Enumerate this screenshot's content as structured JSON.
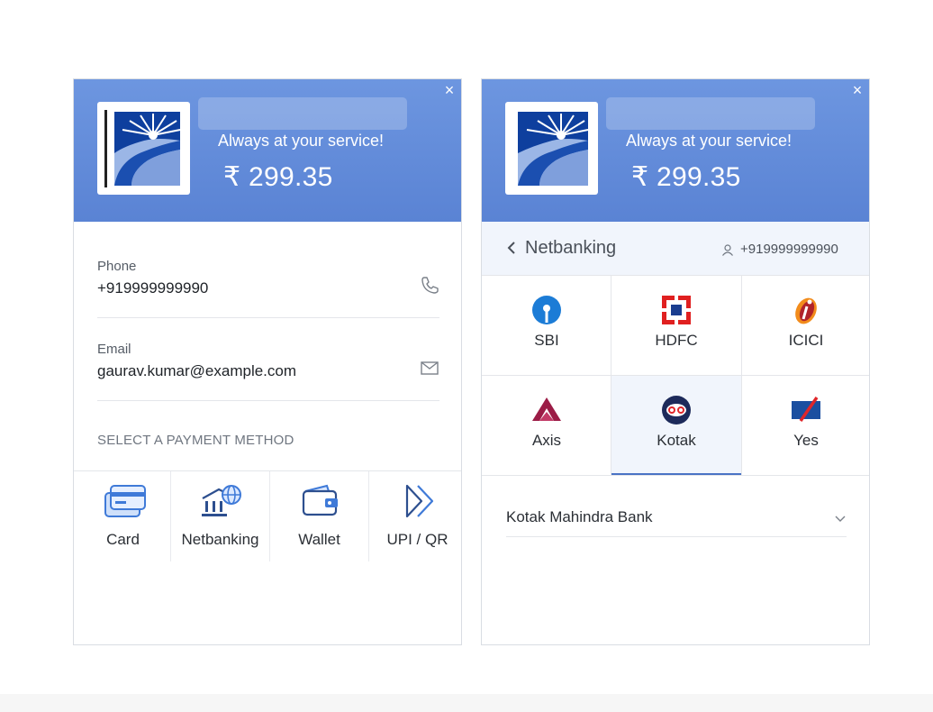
{
  "left_panel": {
    "close_icon": "×",
    "tagline": "Always at your service!",
    "amount": "₹ 299.35",
    "phone": {
      "label": "Phone",
      "value": "+919999999990",
      "icon": "phone-icon"
    },
    "email": {
      "label": "Email",
      "value": "gaurav.kumar@example.com",
      "icon": "envelope-icon"
    },
    "section_label": "SELECT A PAYMENT METHOD",
    "methods": [
      {
        "label": "Card",
        "icon": "card-icon"
      },
      {
        "label": "Netbanking",
        "icon": "bank-globe-icon"
      },
      {
        "label": "Wallet",
        "icon": "wallet-icon"
      },
      {
        "label": "UPI / QR",
        "icon": "upi-icon"
      }
    ]
  },
  "right_panel": {
    "close_icon": "×",
    "tagline": "Always at your service!",
    "amount": "₹ 299.35",
    "nav": {
      "title": "Netbanking",
      "phone": "+919999999990"
    },
    "banks": [
      {
        "label": "SBI",
        "icon": "sbi-logo-icon"
      },
      {
        "label": "HDFC",
        "icon": "hdfc-logo-icon"
      },
      {
        "label": "ICICI",
        "icon": "icici-logo-icon"
      },
      {
        "label": "Axis",
        "icon": "axis-logo-icon"
      },
      {
        "label": "Kotak",
        "icon": "kotak-logo-icon",
        "selected": true
      },
      {
        "label": "Yes",
        "icon": "yes-logo-icon"
      }
    ],
    "bank_select": {
      "value": "Kotak Mahindra Bank"
    }
  },
  "colors": {
    "header_blue": "#5a83d4",
    "accent_blue": "#4a73c5",
    "selected_bg": "#f1f5fc",
    "sbi_blue": "#1c7cd6",
    "hdfc_red": "#e02020",
    "axis_maroon": "#9b1c46",
    "kotak_navy": "#1d2a5a"
  }
}
